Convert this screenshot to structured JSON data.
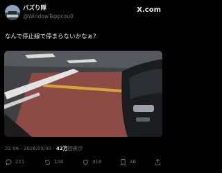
{
  "tweet": {
    "display_name": "バズり隊",
    "handle": "@WindowTappcou0",
    "brand": "X.com",
    "text": "なんで停止線で停まらないかなぁ？",
    "time": "22:06",
    "date": "2026/05/30",
    "views_count": "42万",
    "views_label": "回表示",
    "separator": "·"
  },
  "actions": {
    "replies": "211",
    "reposts": "104",
    "likes": "318",
    "bookmarks": "46"
  },
  "icons": {
    "reply": "reply-icon",
    "repost": "repost-icon",
    "like": "heart-icon",
    "bookmark": "bookmark-icon",
    "share": "share-icon"
  },
  "colors": {
    "background": "#000000",
    "text": "#e7e9ea",
    "muted": "#71767b"
  }
}
